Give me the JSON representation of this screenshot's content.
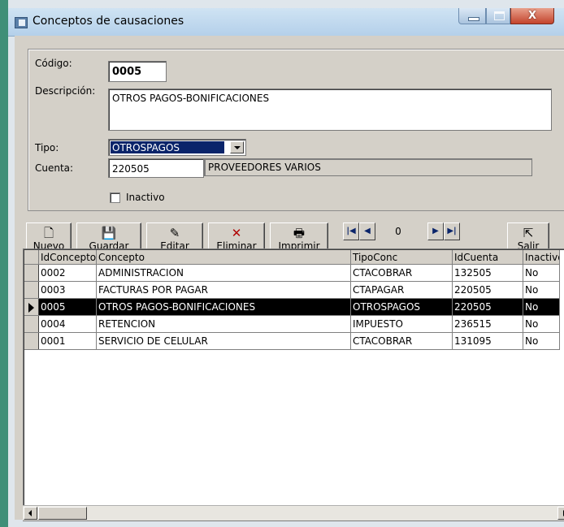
{
  "window": {
    "title": "Conceptos de causaciones"
  },
  "form": {
    "codigo_label": "Código:",
    "codigo_value": "0005",
    "descripcion_label": "Descripción:",
    "descripcion_value": "OTROS PAGOS-BONIFICACIONES",
    "tipo_label": "Tipo:",
    "tipo_value": "OTROSPAGOS",
    "cuenta_label": "Cuenta:",
    "cuenta_code": "220505",
    "cuenta_name": "PROVEEDORES VARIOS",
    "inactivo_label": "Inactivo",
    "inactivo_checked": false
  },
  "toolbar": {
    "nuevo": {
      "label": "Nuevo",
      "underline": "N",
      "rest": "uevo"
    },
    "guardar": {
      "label": "Guardar",
      "underline": "G",
      "rest": "uardar"
    },
    "editar": {
      "label": "Editar",
      "pre": "Edi",
      "underline": "t",
      "rest": "ar"
    },
    "eliminar": {
      "label": "Eliminar",
      "underline": "E",
      "rest": "liminar"
    },
    "imprimir": {
      "label": "Imprimir",
      "underline": "I",
      "rest": "mprimir"
    },
    "salir": {
      "label": "Salir",
      "underline": "S",
      "rest": "alir"
    },
    "record_position": "0"
  },
  "grid": {
    "columns": [
      "IdConcepto",
      "Concepto",
      "TipoConc",
      "IdCuenta",
      "Inactivo"
    ],
    "rows": [
      [
        "0002",
        "ADMINISTRACION",
        "CTACOBRAR",
        "132505",
        "No"
      ],
      [
        "0003",
        "FACTURAS POR PAGAR",
        "CTAPAGAR",
        "220505",
        "No"
      ],
      [
        "0005",
        "OTROS PAGOS-BONIFICACIONES",
        "OTROSPAGOS",
        "220505",
        "No"
      ],
      [
        "0004",
        "RETENCION",
        "IMPUESTO",
        "236515",
        "No"
      ],
      [
        "0001",
        "SERVICIO DE CELULAR",
        "CTACOBRAR",
        "131095",
        "No"
      ]
    ],
    "selected_row": 2
  },
  "colors": {
    "selection": "#000000",
    "combo_highlight": "#0a246a",
    "face": "#d4d0c8"
  }
}
